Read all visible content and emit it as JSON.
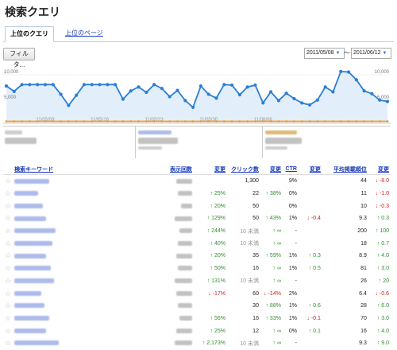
{
  "page": {
    "title": "検索クエリ"
  },
  "tabs": [
    {
      "label": "上位のクエリ"
    },
    {
      "label": "上位のページ"
    }
  ],
  "toolbar": {
    "filter_label": "フィルタ...",
    "date_start": "2011/05/08",
    "date_end": "2011/06/12",
    "date_separator": "〜"
  },
  "chart_data": {
    "type": "line",
    "y_ticks_left": [
      "10,000",
      "5,000"
    ],
    "y_ticks_right": [
      "10,000",
      "5,000"
    ],
    "x_tick_labels": [
      "11/05/09",
      "11/05/16",
      "11/05/23",
      "11/05/30",
      "11/06/06"
    ],
    "ylim": [
      0,
      12000
    ],
    "series": [
      {
        "color": "#2a7fd4",
        "values": [
          7700,
          6600,
          8000,
          8000,
          8000,
          8000,
          8000,
          6000,
          3700,
          5800,
          8000,
          8000,
          8000,
          8000,
          8000,
          5000,
          6700,
          7500,
          6400,
          8000,
          7200,
          5500,
          6800,
          4700,
          3300,
          7700,
          6000,
          5200,
          8000,
          7900,
          5900,
          7500,
          7900,
          4200,
          6500,
          4700,
          6200,
          5100,
          4200,
          3800,
          4800,
          7500,
          6500,
          10700,
          10600,
          9000,
          6700,
          6100,
          4800,
          4500
        ]
      },
      {
        "color": "#f0a030",
        "values": [
          400,
          400,
          400,
          400,
          400,
          400,
          400,
          400,
          400,
          400,
          400,
          400,
          400,
          400,
          400,
          400,
          400,
          400,
          400,
          400,
          400,
          400,
          400,
          400,
          400,
          400,
          400,
          400,
          400,
          400,
          400,
          400,
          400,
          400,
          400,
          400,
          400,
          400,
          400,
          400,
          400,
          400,
          400,
          400,
          400,
          400,
          400,
          400,
          400,
          400
        ]
      }
    ]
  },
  "table": {
    "headers": {
      "keyword": "検索キーワード",
      "impressions": "表示回数",
      "impr_change": "変更",
      "clicks": "クリック数",
      "clicks_change": "変更",
      "ctr": "CTR",
      "ctr_change": "変更",
      "position": "平均掲載順位",
      "pos_change": "変更"
    },
    "rows": [
      {
        "impr_change": "",
        "clicks": "1,300",
        "clicks_change": "",
        "ctr": "9%",
        "ctr_change": "",
        "position": "44",
        "pos_change": "-8.0"
      },
      {
        "impr_change": "25%",
        "clicks": "22",
        "clicks_change": "38%",
        "ctr": "0%",
        "ctr_change": "",
        "position": "11",
        "pos_change": "-1.0"
      },
      {
        "impr_change": "20%",
        "clicks": "50",
        "clicks_change": "",
        "ctr": "0%",
        "ctr_change": "",
        "position": "10",
        "pos_change": "-0.3"
      },
      {
        "impr_change": "129%",
        "clicks": "50",
        "clicks_change": "43%",
        "ctr": "1%",
        "ctr_change": "-0.4",
        "position": "9.3",
        "pos_change": "0.3"
      },
      {
        "impr_change": "244%",
        "clicks": "10 未満",
        "clicks_change": "∞",
        "ctr": "-",
        "ctr_change": "",
        "position": "200",
        "pos_change": "100"
      },
      {
        "impr_change": "40%",
        "clicks": "10 未満",
        "clicks_change": "∞",
        "ctr": "-",
        "ctr_change": "",
        "position": "18",
        "pos_change": "0.7"
      },
      {
        "impr_change": "20%",
        "clicks": "35",
        "clicks_change": "59%",
        "ctr": "1%",
        "ctr_change": "0.3",
        "position": "8.9",
        "pos_change": "4.0"
      },
      {
        "impr_change": "50%",
        "clicks": "16",
        "clicks_change": "∞",
        "ctr": "1%",
        "ctr_change": "0.5",
        "position": "81",
        "pos_change": "3.0"
      },
      {
        "impr_change": "131%",
        "clicks": "10 未満",
        "clicks_change": "∞",
        "ctr": "-",
        "ctr_change": "",
        "position": "26",
        "pos_change": "20"
      },
      {
        "impr_change": "-17%",
        "clicks": "60",
        "clicks_change": "-14%",
        "ctr": "2%",
        "ctr_change": "",
        "position": "6.4",
        "pos_change": "-0.6"
      },
      {
        "impr_change": "",
        "clicks": "30",
        "clicks_change": "88%",
        "ctr": "1%",
        "ctr_change": "0.6",
        "position": "28",
        "pos_change": "6.0"
      },
      {
        "impr_change": "56%",
        "clicks": "16",
        "clicks_change": "33%",
        "ctr": "1%",
        "ctr_change": "-0.1",
        "position": "70",
        "pos_change": "3.0"
      },
      {
        "impr_change": "25%",
        "clicks": "12",
        "clicks_change": "∞",
        "ctr": "0%",
        "ctr_change": "0.1",
        "position": "16",
        "pos_change": "4.0"
      },
      {
        "impr_change": "2,173%",
        "clicks": "10 未満",
        "clicks_change": "∞",
        "ctr": "-",
        "ctr_change": "",
        "position": "9.3",
        "pos_change": "9.0"
      }
    ]
  }
}
